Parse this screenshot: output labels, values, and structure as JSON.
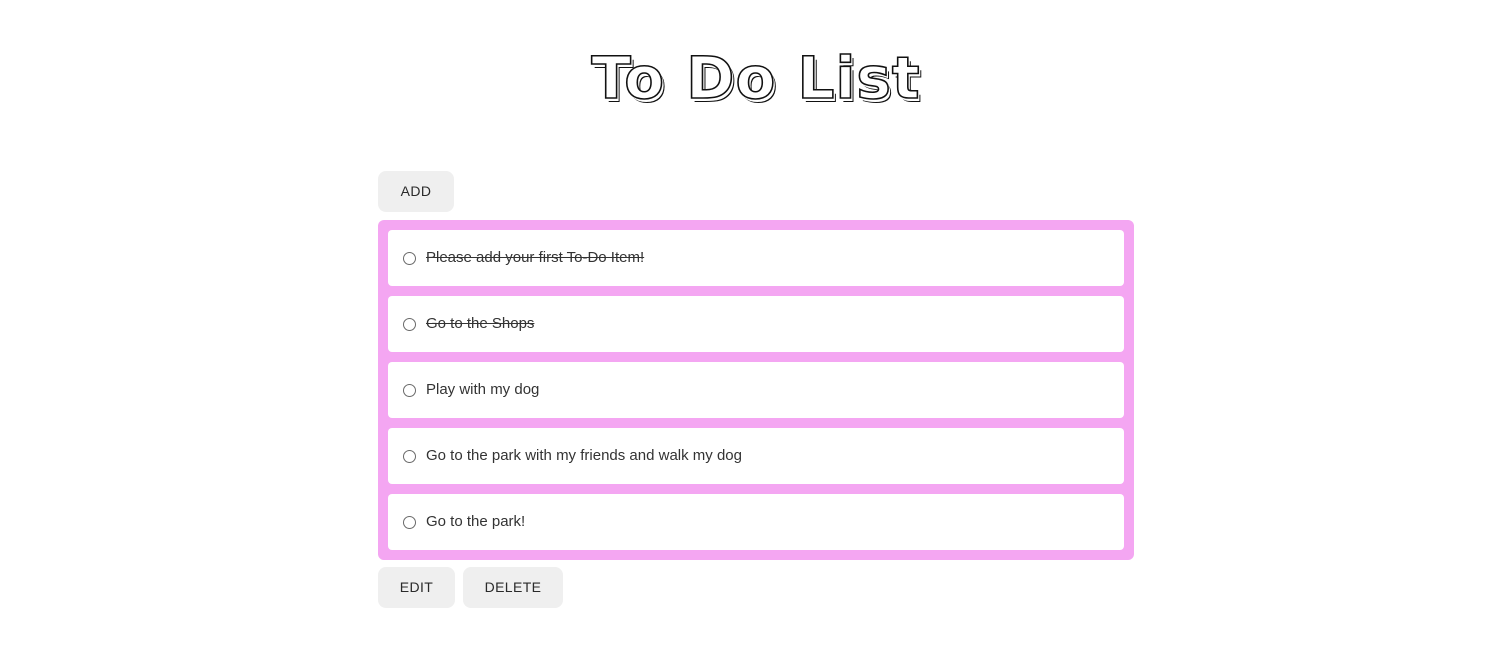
{
  "title": "To Do List",
  "buttons": {
    "add": "ADD",
    "edit": "EDIT",
    "delete": "DELETE"
  },
  "todo_items": [
    {
      "text": "Please add your first To-Do Item!",
      "completed": true
    },
    {
      "text": "Go to the Shops",
      "completed": true
    },
    {
      "text": "Play with my dog",
      "completed": false
    },
    {
      "text": "Go to the park with my friends and walk my dog",
      "completed": false
    },
    {
      "text": "Go to the park!",
      "completed": false
    }
  ],
  "colors": {
    "list_background": "#f4a6f2",
    "button_background": "#efefef",
    "item_background": "#ffffff"
  }
}
